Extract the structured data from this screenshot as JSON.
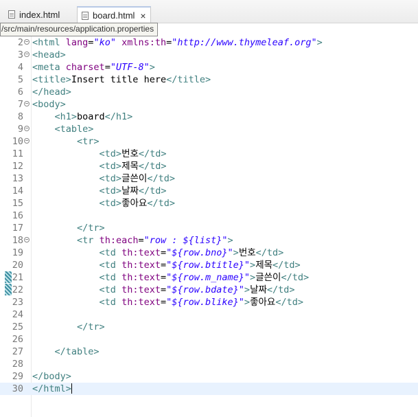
{
  "tabs": [
    {
      "label": "index.html",
      "icon": "html-file-icon",
      "active": false
    },
    {
      "label": "board.html",
      "icon": "html-file-icon",
      "active": true,
      "close": "×"
    }
  ],
  "tooltip": "/src/main/resources/application.properties",
  "colors": {
    "tag": "#3f7f7f",
    "attr": "#7f007f",
    "value": "#2a00ff",
    "text": "#000000",
    "line_number": "#787878",
    "current_line": "#e8f2fe"
  },
  "lines": [
    {
      "n": "2",
      "fold": true,
      "tokens": [
        [
          "t",
          "<html"
        ],
        [
          "p",
          " "
        ],
        [
          "a",
          "lang"
        ],
        [
          "p",
          "="
        ],
        [
          "v",
          "\"ko\""
        ],
        [
          "p",
          " "
        ],
        [
          "a",
          "xmlns:th"
        ],
        [
          "p",
          "="
        ],
        [
          "v",
          "\"http://www.thymeleaf.org\""
        ],
        [
          "t",
          ">"
        ]
      ]
    },
    {
      "n": "3",
      "fold": true,
      "tokens": [
        [
          "t",
          "<head>"
        ]
      ]
    },
    {
      "n": "4",
      "tokens": [
        [
          "t",
          "<meta"
        ],
        [
          "p",
          " "
        ],
        [
          "a",
          "charset"
        ],
        [
          "p",
          "="
        ],
        [
          "v",
          "\"UTF-8\""
        ],
        [
          "t",
          ">"
        ]
      ]
    },
    {
      "n": "5",
      "tokens": [
        [
          "t",
          "<title>"
        ],
        [
          "p",
          "Insert title here"
        ],
        [
          "t",
          "</title>"
        ]
      ]
    },
    {
      "n": "6",
      "tokens": [
        [
          "t",
          "</head>"
        ]
      ]
    },
    {
      "n": "7",
      "fold": true,
      "tokens": [
        [
          "t",
          "<body>"
        ]
      ]
    },
    {
      "n": "8",
      "tokens": [
        [
          "p",
          "    "
        ],
        [
          "t",
          "<h1>"
        ],
        [
          "p",
          "board"
        ],
        [
          "t",
          "</h1>"
        ]
      ]
    },
    {
      "n": "9",
      "fold": true,
      "tokens": [
        [
          "p",
          "    "
        ],
        [
          "t",
          "<table>"
        ]
      ]
    },
    {
      "n": "10",
      "fold": true,
      "tokens": [
        [
          "p",
          "        "
        ],
        [
          "t",
          "<tr>"
        ]
      ]
    },
    {
      "n": "11",
      "tokens": [
        [
          "p",
          "            "
        ],
        [
          "t",
          "<td>"
        ],
        [
          "p",
          "번호"
        ],
        [
          "t",
          "</td>"
        ]
      ]
    },
    {
      "n": "12",
      "tokens": [
        [
          "p",
          "            "
        ],
        [
          "t",
          "<td>"
        ],
        [
          "p",
          "제목"
        ],
        [
          "t",
          "</td>"
        ]
      ]
    },
    {
      "n": "13",
      "tokens": [
        [
          "p",
          "            "
        ],
        [
          "t",
          "<td>"
        ],
        [
          "p",
          "글쓴이"
        ],
        [
          "t",
          "</td>"
        ]
      ]
    },
    {
      "n": "14",
      "tokens": [
        [
          "p",
          "            "
        ],
        [
          "t",
          "<td>"
        ],
        [
          "p",
          "날짜"
        ],
        [
          "t",
          "</td>"
        ]
      ]
    },
    {
      "n": "15",
      "tokens": [
        [
          "p",
          "            "
        ],
        [
          "t",
          "<td>"
        ],
        [
          "p",
          "좋아요"
        ],
        [
          "t",
          "</td>"
        ]
      ]
    },
    {
      "n": "16",
      "tokens": []
    },
    {
      "n": "17",
      "tokens": [
        [
          "p",
          "        "
        ],
        [
          "t",
          "</tr>"
        ]
      ]
    },
    {
      "n": "18",
      "fold": true,
      "tokens": [
        [
          "p",
          "        "
        ],
        [
          "t",
          "<tr"
        ],
        [
          "p",
          " "
        ],
        [
          "a",
          "th:each"
        ],
        [
          "p",
          "="
        ],
        [
          "v",
          "\"row : ${list}\""
        ],
        [
          "t",
          ">"
        ]
      ]
    },
    {
      "n": "19",
      "tokens": [
        [
          "p",
          "            "
        ],
        [
          "t",
          "<td"
        ],
        [
          "p",
          " "
        ],
        [
          "a",
          "th:text"
        ],
        [
          "p",
          "="
        ],
        [
          "v",
          "\"${row.bno}\""
        ],
        [
          "t",
          ">"
        ],
        [
          "p",
          "번호"
        ],
        [
          "t",
          "</td>"
        ]
      ]
    },
    {
      "n": "20",
      "tokens": [
        [
          "p",
          "            "
        ],
        [
          "t",
          "<td"
        ],
        [
          "p",
          " "
        ],
        [
          "a",
          "th:text"
        ],
        [
          "p",
          "="
        ],
        [
          "v",
          "\"${row.btitle}\""
        ],
        [
          "t",
          ">"
        ],
        [
          "p",
          "제목"
        ],
        [
          "t",
          "</td>"
        ]
      ]
    },
    {
      "n": "21",
      "annot": true,
      "tokens": [
        [
          "p",
          "            "
        ],
        [
          "t",
          "<td"
        ],
        [
          "p",
          " "
        ],
        [
          "a",
          "th:text"
        ],
        [
          "p",
          "="
        ],
        [
          "v",
          "\"${row.m_name}\""
        ],
        [
          "t",
          ">"
        ],
        [
          "p",
          "글쓴이"
        ],
        [
          "t",
          "</td>"
        ]
      ]
    },
    {
      "n": "22",
      "annot": true,
      "tokens": [
        [
          "p",
          "            "
        ],
        [
          "t",
          "<td"
        ],
        [
          "p",
          " "
        ],
        [
          "a",
          "th:text"
        ],
        [
          "p",
          "="
        ],
        [
          "v",
          "\"${row.bdate}\""
        ],
        [
          "t",
          ">"
        ],
        [
          "p",
          "날짜"
        ],
        [
          "t",
          "</td>"
        ]
      ]
    },
    {
      "n": "23",
      "tokens": [
        [
          "p",
          "            "
        ],
        [
          "t",
          "<td"
        ],
        [
          "p",
          " "
        ],
        [
          "a",
          "th:text"
        ],
        [
          "p",
          "="
        ],
        [
          "v",
          "\"${row.blike}\""
        ],
        [
          "t",
          ">"
        ],
        [
          "p",
          "좋아요"
        ],
        [
          "t",
          "</td>"
        ]
      ]
    },
    {
      "n": "24",
      "tokens": []
    },
    {
      "n": "25",
      "tokens": [
        [
          "p",
          "        "
        ],
        [
          "t",
          "</tr>"
        ]
      ]
    },
    {
      "n": "26",
      "tokens": []
    },
    {
      "n": "27",
      "tokens": [
        [
          "p",
          "    "
        ],
        [
          "t",
          "</table>"
        ]
      ]
    },
    {
      "n": "28",
      "tokens": []
    },
    {
      "n": "29",
      "tokens": [
        [
          "t",
          "</body>"
        ]
      ]
    },
    {
      "n": "30",
      "current": true,
      "tokens": [
        [
          "t",
          "</html>"
        ]
      ]
    }
  ]
}
